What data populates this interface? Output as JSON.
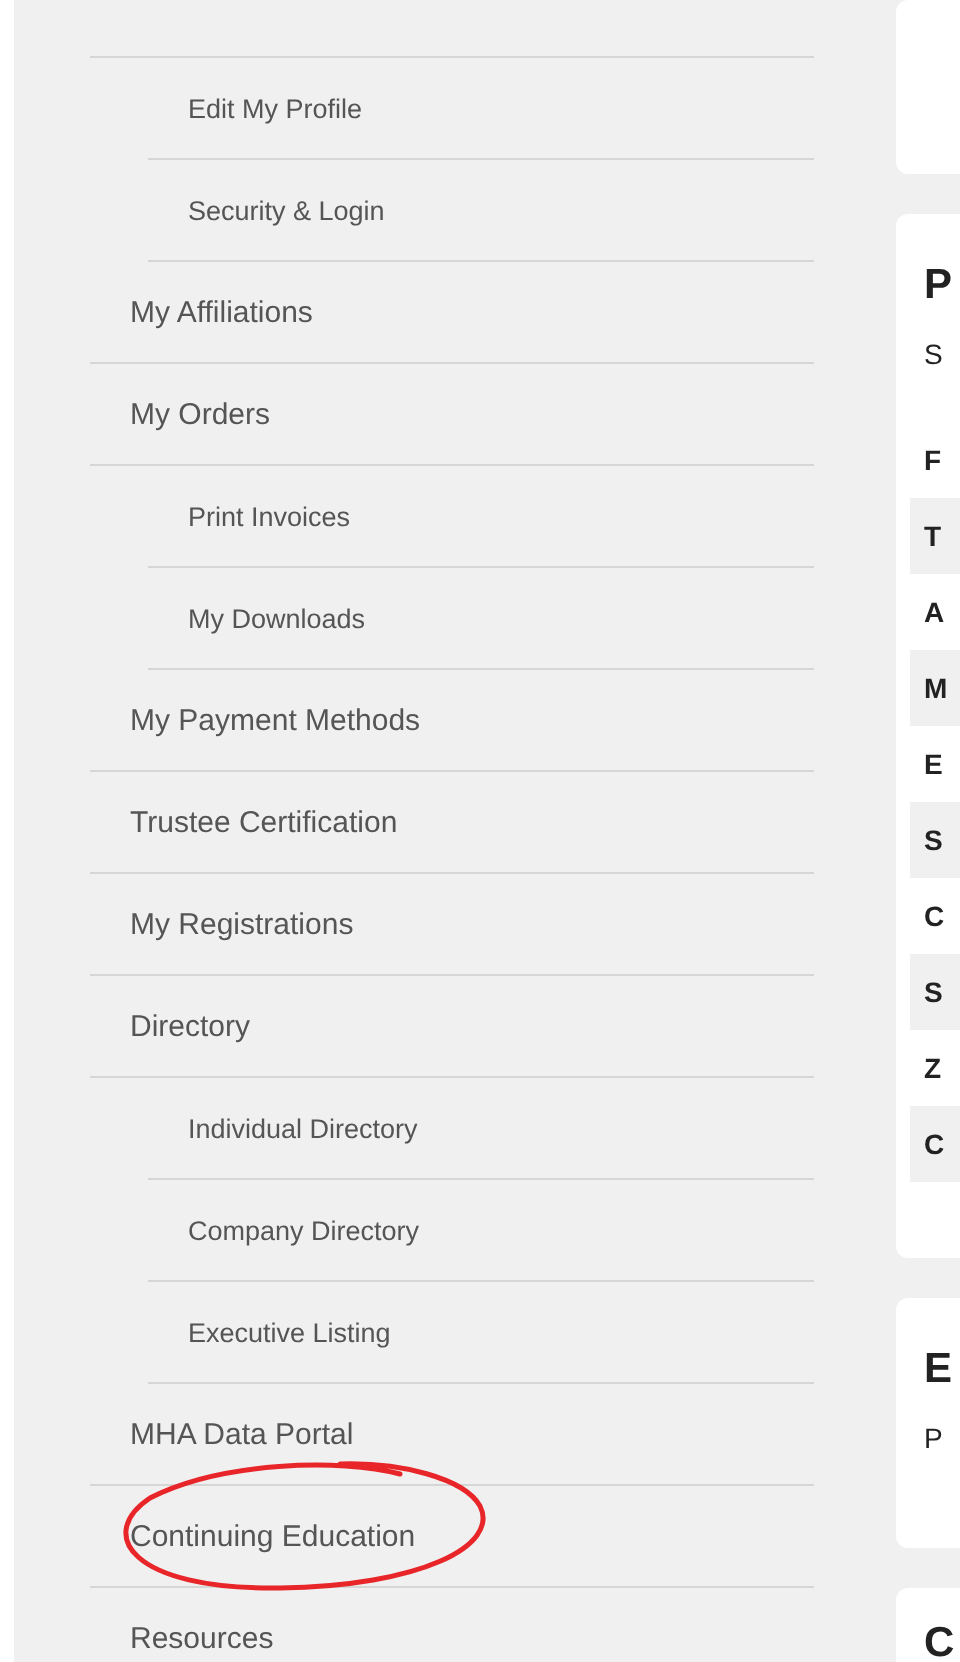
{
  "sidebar": {
    "items": [
      {
        "label": "Edit My Profile",
        "kind": "sub",
        "circled": false
      },
      {
        "label": "Security & Login",
        "kind": "sub",
        "circled": false
      },
      {
        "label": "My Affiliations",
        "kind": "top",
        "circled": false
      },
      {
        "label": "My Orders",
        "kind": "top",
        "circled": false
      },
      {
        "label": "Print Invoices",
        "kind": "sub",
        "circled": false
      },
      {
        "label": "My Downloads",
        "kind": "sub",
        "circled": false
      },
      {
        "label": "My Payment Methods",
        "kind": "top",
        "circled": false
      },
      {
        "label": "Trustee Certification",
        "kind": "top",
        "circled": false
      },
      {
        "label": "My Registrations",
        "kind": "top",
        "circled": false
      },
      {
        "label": "Directory",
        "kind": "top",
        "circled": false
      },
      {
        "label": "Individual Directory",
        "kind": "sub",
        "circled": false
      },
      {
        "label": "Company Directory",
        "kind": "sub",
        "circled": false
      },
      {
        "label": "Executive Listing",
        "kind": "sub",
        "circled": false
      },
      {
        "label": "MHA Data Portal",
        "kind": "top",
        "circled": false
      },
      {
        "label": "Continuing Education",
        "kind": "top",
        "circled": true
      },
      {
        "label": "Resources",
        "kind": "top",
        "circled": false
      }
    ]
  },
  "profile_card": {
    "heading": "P",
    "subtitle": "S",
    "rows": [
      "F",
      "T",
      "A",
      "M",
      "E",
      "S",
      "C",
      "S",
      "Z",
      "C"
    ]
  },
  "second_card": {
    "heading": "E",
    "text": "P"
  },
  "third_card": {
    "heading": "C"
  }
}
